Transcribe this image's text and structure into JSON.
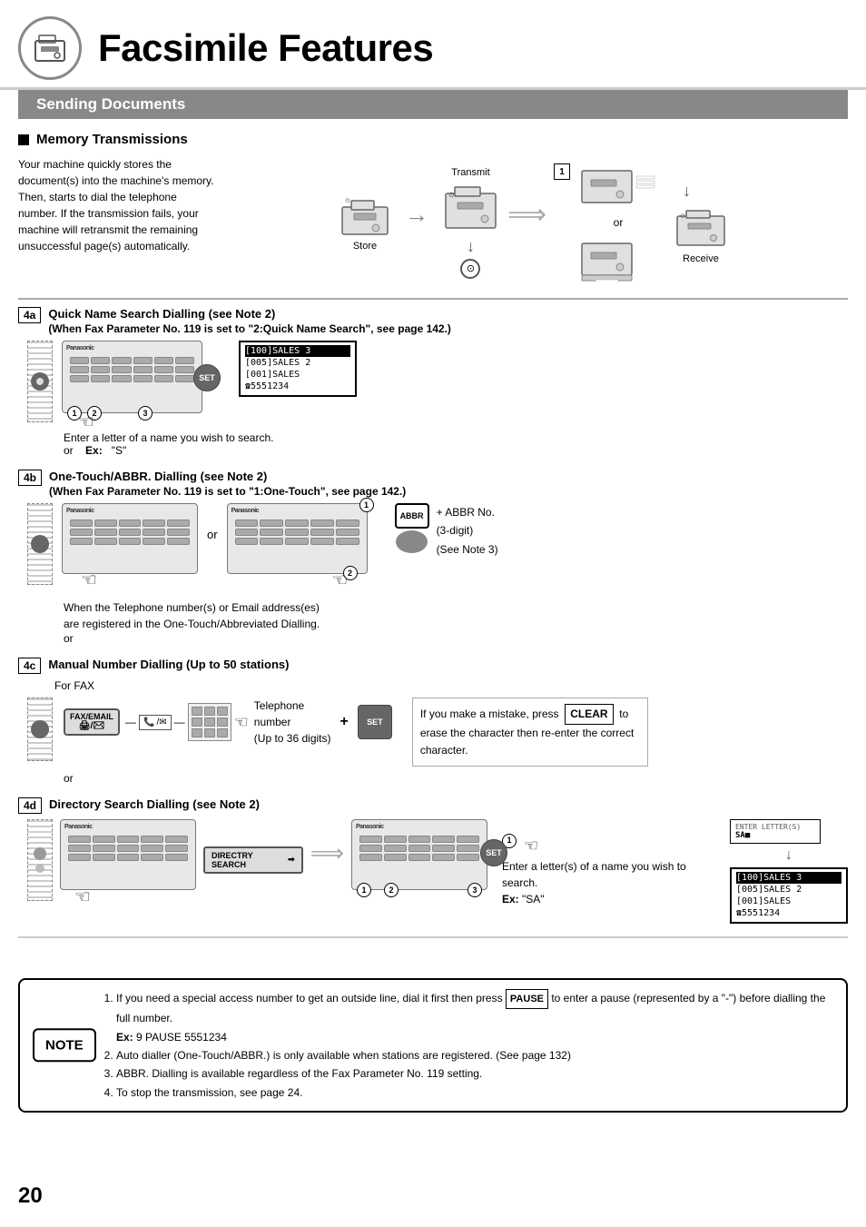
{
  "page": {
    "number": "20",
    "title": "Facsimile Features",
    "subtitle": "Sending Documents"
  },
  "header": {
    "icon_label": "fax-icon"
  },
  "section": {
    "title": "Memory Transmissions",
    "description": "Your machine quickly stores the document(s) into the machine's memory. Then, starts to dial the telephone number. If the transmission fails, your machine will retransmit the remaining unsuccessful page(s) automatically.",
    "diagram_labels": {
      "transmit": "Transmit",
      "store": "Store",
      "receive": "Receive",
      "or": "or"
    }
  },
  "step_4a": {
    "badge": "4a",
    "title": "Quick Name Search Dialling (see Note 2)",
    "subtitle": "(When Fax Parameter No. 119 is set to \"2:Quick Name Search\", see page 142.)",
    "instruction": "Enter a letter of a name you wish to search.",
    "or": "or",
    "example_label": "Ex:",
    "example_value": "\"S\"",
    "search_results": [
      "[100]SALES 3",
      "[005]SALES 2",
      "[001]SALES",
      "☎5551234"
    ]
  },
  "step_4b": {
    "badge": "4b",
    "title": "One-Touch/ABBR. Dialling (see Note 2)",
    "subtitle": "(When Fax Parameter No. 119 is set to \"1:One-Touch\", see page 142.)",
    "instruction": "When the Telephone number(s) or Email address(es) are registered in the One-Touch/Abbreviated Dialling.",
    "or": "or",
    "abbr_plus": "+ ABBR No.",
    "abbr_digits": "(3-digit)",
    "abbr_note": "(See Note 3)"
  },
  "step_4c": {
    "badge": "4c",
    "title": "Manual Number Dialling (Up to 50 stations)",
    "for_fax": "For FAX",
    "telephone_label": "Telephone",
    "telephone_detail": "number",
    "telephone_digits": "(Up to 36 digits)",
    "plus": "+",
    "mistake_text": "If you make a mistake, press",
    "clear_label": "CLEAR",
    "mistake_detail": "to erase the character then re-enter the correct character.",
    "or": "or"
  },
  "step_4d": {
    "badge": "4d",
    "title": "Directory Search Dialling (see Note 2)",
    "instruction": "Enter a letter(s) of a name you wish to search.",
    "example_label": "Ex:",
    "example_value": "\"SA\"",
    "dir_search_label": "DIRECTRY SEARCH",
    "search_results": [
      "[100]SALES 3",
      "[005]SALES 2",
      "[001]SALES",
      "☎5551234"
    ],
    "enter_letters": "ENTER LETTER(S)",
    "enter_value": "SA■"
  },
  "notes": {
    "title": "NOTE",
    "items": [
      "If you need a special access number to get an outside line, dial it first then press PAUSE to enter a pause (represented by a \"-\") before dialling the full number.",
      "Ex: 9 PAUSE 5551234",
      "Auto dialler (One-Touch/ABBR.) is only available when stations are registered. (See page 132)",
      "ABBR. Dialling is available regardless of the Fax Parameter No. 119 setting.",
      "To stop the transmission, see page 24."
    ],
    "pause_label": "PAUSE"
  }
}
